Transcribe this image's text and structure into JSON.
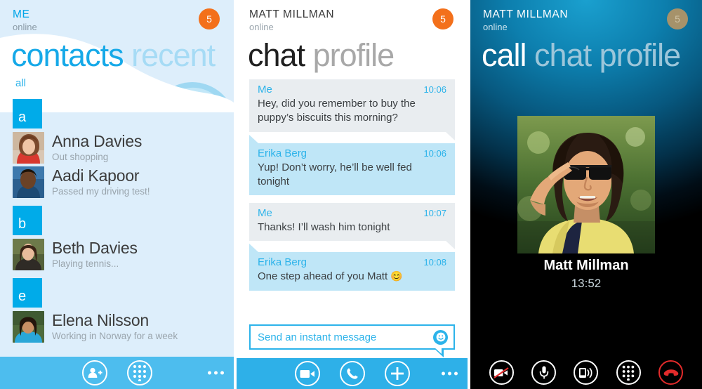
{
  "panels": {
    "contacts": {
      "header": {
        "name": "ME",
        "status": "online",
        "badge": "5"
      },
      "pivot": {
        "active": "contacts",
        "next": "recent"
      },
      "filter_label": "all",
      "groups": [
        {
          "letter": "a",
          "contacts": [
            {
              "name": "Anna Davies",
              "mood": "Out shopping"
            },
            {
              "name": "Aadi Kapoor",
              "mood": "Passed my driving test!"
            }
          ]
        },
        {
          "letter": "b",
          "contacts": [
            {
              "name": "Beth Davies",
              "mood": "Playing tennis..."
            }
          ]
        },
        {
          "letter": "e",
          "contacts": [
            {
              "name": "Elena Nilsson",
              "mood": "Working in Norway for a week"
            }
          ]
        }
      ],
      "appbar": {
        "add_contact_label": "add contact",
        "dialpad_label": "dial pad",
        "more_label": "more"
      }
    },
    "chat": {
      "header": {
        "name": "MATT MILLMAN",
        "status": "online",
        "badge": "5"
      },
      "pivot": {
        "active": "chat",
        "next": "profile"
      },
      "messages": [
        {
          "who": "Me",
          "time": "10:06",
          "text": "Hey, did you remember to buy the puppy’s biscuits this morning?",
          "side": "me"
        },
        {
          "who": "Erika Berg",
          "time": "10:06",
          "text": "Yup! Don’t worry, he’ll be well fed tonight",
          "side": "them"
        },
        {
          "who": "Me",
          "time": "10:07",
          "text": "Thanks! I’ll wash him tonight",
          "side": "me"
        },
        {
          "who": "Erika Berg",
          "time": "10:08",
          "text": "One step ahead of you Matt",
          "emoji": "😊",
          "side": "them"
        }
      ],
      "composer": {
        "placeholder": "Send an instant message",
        "emoji_label": "emoticons"
      },
      "appbar": {
        "video_call_label": "video call",
        "voice_call_label": "call",
        "add_label": "add",
        "more_label": "more"
      }
    },
    "call": {
      "header": {
        "name": "MATT MILLMAN",
        "status": "online",
        "badge": "5"
      },
      "pivot": {
        "active": "call",
        "next": "chat profile"
      },
      "caller_name": "Matt Millman",
      "duration": "13:52",
      "appbar": {
        "video_off_label": "video off",
        "mute_label": "mute",
        "speaker_label": "speaker",
        "dialpad_label": "dial pad",
        "end_call_label": "end call"
      }
    }
  },
  "colors": {
    "skype_blue": "#00AFF0",
    "accent_orange": "#F3701B",
    "bubble_me": "#E9EDF0",
    "bubble_them": "#BFE6F7",
    "end_call_red": "#E32B2B"
  }
}
